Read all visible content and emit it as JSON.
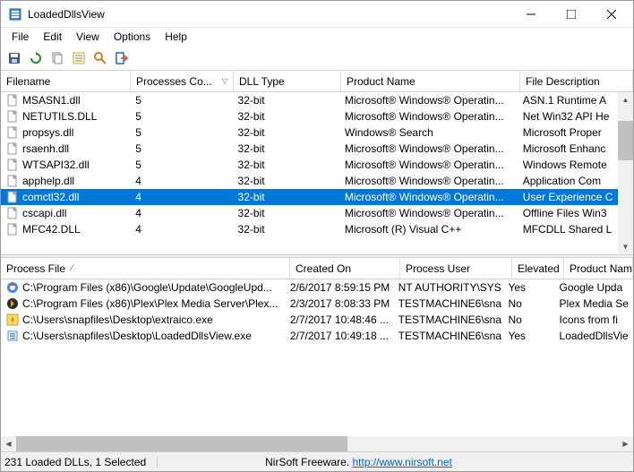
{
  "window": {
    "title": "LoadedDllsView"
  },
  "menu": {
    "file": "File",
    "edit": "Edit",
    "view": "View",
    "options": "Options",
    "help": "Help"
  },
  "top": {
    "columns": {
      "filename": "Filename",
      "processes": "Processes Co...",
      "dlltype": "DLL Type",
      "product": "Product Name",
      "filedesc": "File Description"
    },
    "col_widths": {
      "filename": 145,
      "processes": 115,
      "dlltype": 120,
      "product": 200,
      "filedesc": 130
    },
    "rows": [
      {
        "filename": "MSASN1.dll",
        "processes": "5",
        "dlltype": "32-bit",
        "product": "Microsoft® Windows® Operatin...",
        "filedesc": "ASN.1 Runtime A",
        "selected": false
      },
      {
        "filename": "NETUTILS.DLL",
        "processes": "5",
        "dlltype": "32-bit",
        "product": "Microsoft® Windows® Operatin...",
        "filedesc": "Net Win32 API He",
        "selected": false
      },
      {
        "filename": "propsys.dll",
        "processes": "5",
        "dlltype": "32-bit",
        "product": "Windows® Search",
        "filedesc": "Microsoft Proper",
        "selected": false
      },
      {
        "filename": "rsaenh.dll",
        "processes": "5",
        "dlltype": "32-bit",
        "product": "Microsoft® Windows® Operatin...",
        "filedesc": "Microsoft Enhanc",
        "selected": false
      },
      {
        "filename": "WTSAPI32.dll",
        "processes": "5",
        "dlltype": "32-bit",
        "product": "Microsoft® Windows® Operatin...",
        "filedesc": "Windows Remote",
        "selected": false
      },
      {
        "filename": "apphelp.dll",
        "processes": "4",
        "dlltype": "32-bit",
        "product": "Microsoft® Windows® Operatin...",
        "filedesc": "Application Com",
        "selected": false
      },
      {
        "filename": "comctl32.dll",
        "processes": "4",
        "dlltype": "32-bit",
        "product": "Microsoft® Windows® Operatin...",
        "filedesc": "User Experience C",
        "selected": true
      },
      {
        "filename": "cscapi.dll",
        "processes": "4",
        "dlltype": "32-bit",
        "product": "Microsoft® Windows® Operatin...",
        "filedesc": "Offline Files Win3",
        "selected": false
      },
      {
        "filename": "MFC42.DLL",
        "processes": "4",
        "dlltype": "32-bit",
        "product": "Microsoft (R) Visual C++",
        "filedesc": "MFCDLL Shared L",
        "selected": false
      }
    ]
  },
  "bottom": {
    "columns": {
      "processfile": "Process File",
      "created": "Created On",
      "user": "Process User",
      "elevated": "Elevated",
      "product": "Product Nam"
    },
    "col_widths": {
      "processfile": 323,
      "created": 123,
      "user": 125,
      "elevated": 58,
      "product": 90
    },
    "rows": [
      {
        "icon": "google",
        "processfile": "C:\\Program Files (x86)\\Google\\Update\\GoogleUpd...",
        "created": "2/6/2017 8:59:15 PM",
        "user": "NT AUTHORITY\\SYS...",
        "elevated": "Yes",
        "product": "Google Upda"
      },
      {
        "icon": "plex",
        "processfile": "C:\\Program Files (x86)\\Plex\\Plex Media Server\\Plex...",
        "created": "2/3/2017 8:08:33 PM",
        "user": "TESTMACHINE6\\sna...",
        "elevated": "No",
        "product": "Plex Media Se"
      },
      {
        "icon": "extra",
        "processfile": "C:\\Users\\snapfiles\\Desktop\\extraico.exe",
        "created": "2/7/2017 10:48:46 ...",
        "user": "TESTMACHINE6\\sna...",
        "elevated": "No",
        "product": "Icons from fi"
      },
      {
        "icon": "ldv",
        "processfile": "C:\\Users\\snapfiles\\Desktop\\LoadedDllsView.exe",
        "created": "2/7/2017 10:49:18 ...",
        "user": "TESTMACHINE6\\sna...",
        "elevated": "Yes",
        "product": "LoadedDllsVie"
      }
    ]
  },
  "status": {
    "left": "231 Loaded DLLs, 1 Selected",
    "right_label": "NirSoft Freeware. ",
    "right_url": "http://www.nirsoft.net"
  }
}
